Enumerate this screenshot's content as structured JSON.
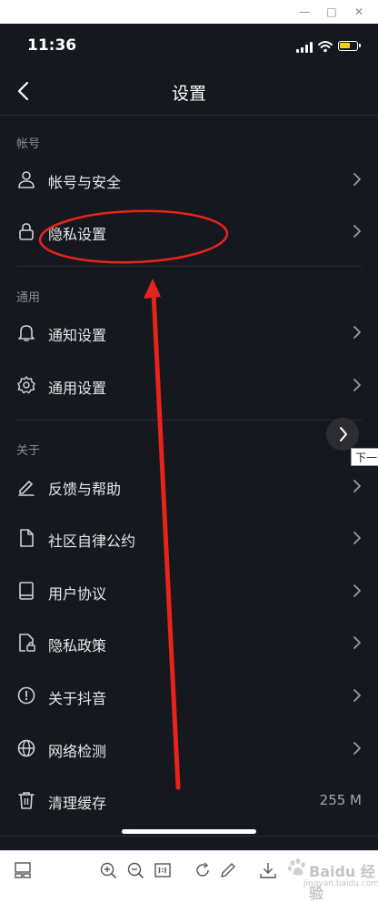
{
  "window": {
    "minimize": "—",
    "maximize": "□",
    "close": "✕"
  },
  "status_bar": {
    "time": "11:36",
    "battery_color": "#f5d400"
  },
  "nav": {
    "title": "设置",
    "back_icon": "chevron-left-icon"
  },
  "sections": {
    "account": {
      "header": "帐号",
      "items": [
        {
          "label": "帐号与安全",
          "icon": "person-icon"
        },
        {
          "label": "隐私设置",
          "icon": "lock-icon"
        }
      ]
    },
    "general": {
      "header": "通用",
      "items": [
        {
          "label": "通知设置",
          "icon": "bell-icon"
        },
        {
          "label": "通用设置",
          "icon": "gear-icon"
        }
      ]
    },
    "about": {
      "header": "关于",
      "items": [
        {
          "label": "反馈与帮助",
          "icon": "pencil-icon"
        },
        {
          "label": "社区自律公约",
          "icon": "document-icon"
        },
        {
          "label": "用户协议",
          "icon": "book-icon"
        },
        {
          "label": "隐私政策",
          "icon": "document-lock-icon"
        },
        {
          "label": "关于抖音",
          "icon": "info-icon"
        },
        {
          "label": "网络检测",
          "icon": "globe-icon"
        },
        {
          "label": "清理缓存",
          "icon": "trash-icon",
          "value": "255 M"
        }
      ]
    }
  },
  "overlay": {
    "next_tooltip": "下一",
    "annotation_color": "#e8231c"
  },
  "watermark": {
    "text": "Baidu 经验",
    "url": "jingyan.baidu.com"
  },
  "colors": {
    "phone_bg": "#16181f",
    "divider": "#2a2d36",
    "text": "#e6e7ea",
    "muted": "#8a8c93"
  }
}
